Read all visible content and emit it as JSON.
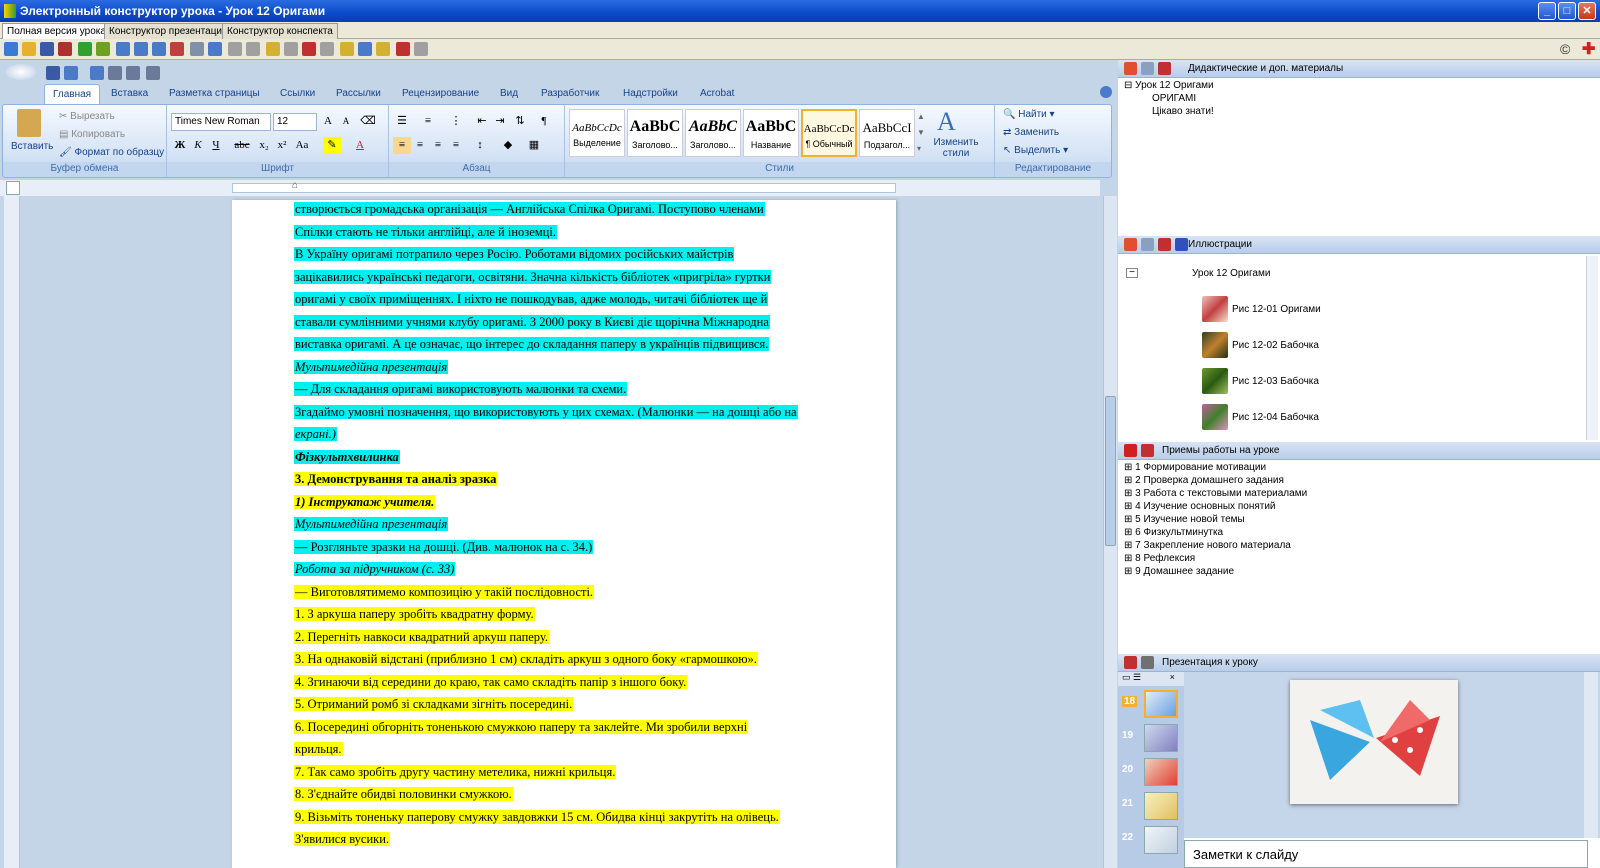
{
  "window": {
    "title": "Электронный конструктор урока - Урок 12 Оригами",
    "min": "_",
    "max": "□",
    "close": "✕"
  },
  "mode_tabs": [
    "Полная версия урока",
    "Конструктор презентации",
    "Конструктор конспекта"
  ],
  "ribbon": {
    "tabs": [
      "Главная",
      "Вставка",
      "Разметка страницы",
      "Ссылки",
      "Рассылки",
      "Рецензирование",
      "Вид",
      "Разработчик",
      "Надстройки",
      "Acrobat"
    ],
    "clipboard": {
      "paste": "Вставить",
      "cut": "Вырезать",
      "copy": "Копировать",
      "format_painter": "Формат по образцу",
      "label": "Буфер обмена"
    },
    "font": {
      "name": "Times New Roman",
      "size": "12",
      "label": "Шрифт"
    },
    "paragraph": {
      "label": "Абзац"
    },
    "styles": {
      "items": [
        {
          "sample": "AaBbCcDc",
          "name": "Выделение"
        },
        {
          "sample": "AaBbC",
          "name": "Заголово..."
        },
        {
          "sample": "AaBbC",
          "name": "Заголово..."
        },
        {
          "sample": "AaBbC",
          "name": "Название"
        },
        {
          "sample": "AaBbCcDc",
          "name": "¶ Обычный"
        },
        {
          "sample": "AaBbCcI",
          "name": "Подзагол..."
        }
      ],
      "change": "Изменить стили",
      "label": "Стили"
    },
    "editing": {
      "find": "Найти",
      "replace": "Заменить",
      "select": "Выделить",
      "label": "Редактирование"
    }
  },
  "document": {
    "lines": [
      {
        "t": "створюється громадська організація — Англійська Спілка Оригамі. Поступово членами",
        "h": "c"
      },
      {
        "t": "Спілки стають не тільки англійці, але й іноземці.",
        "h": "c"
      },
      {
        "t": "В Україну оригамі потрапило через Росію. Роботами відомих російських майстрів",
        "h": "c"
      },
      {
        "t": "зацікавились українські педагоги, освітяни. Значна кількість бібліотек «пригріла» гуртки",
        "h": "c"
      },
      {
        "t": "оригамі у своїх приміщеннях. І ніхто не пошкодував, адже молодь, читачі бібліотек ще й",
        "h": "c"
      },
      {
        "t": "ставали сумлінними учнями клубу оригамі. З 2000 року в Києві діє щорічна Міжнародна",
        "h": "c"
      },
      {
        "t": "виставка оригамі. А це означає, що інтерес до складання паперу в українців підвищився.",
        "h": "c"
      },
      {
        "t": "Мультимедійна презентація",
        "h": "c",
        "s": "i"
      },
      {
        "t": "— Для складання оригамі використовують малюнки та схеми.",
        "h": "c"
      },
      {
        "t": "Згадаймо умовні позначення, що використовують у цих схемах. (Малюнки — на дошці або на",
        "h": "c"
      },
      {
        "t": "екрані.)",
        "h": "c",
        "s": "i"
      },
      {
        "t": "Фізкультхвилинка",
        "h": "c",
        "s": "bi"
      },
      {
        "t": "3. Демонстрування та аналіз зразка",
        "h": "y",
        "s": "b"
      },
      {
        "t": "1) Інструктаж учителя.",
        "h": "y",
        "s": "bi"
      },
      {
        "t": "Мультимедійна презентація",
        "h": "c",
        "s": "i"
      },
      {
        "t": "— Розгляньте зразки на дошці. (Див. малюнок на с. 34.)",
        "h": "c"
      },
      {
        "t": "Робота за підручником (с. 33)",
        "h": "c",
        "s": "i"
      },
      {
        "t": "— Виготовлятимемо композицію у такій послідовності.",
        "h": "y"
      },
      {
        "t": "1. З аркуша паперу зробіть квадратну форму.",
        "h": "y"
      },
      {
        "t": "2. Перегніть навкоси квадратний аркуш паперу.",
        "h": "y"
      },
      {
        "t": "3. На однаковій відстані (приблизно 1 см) складіть аркуш з одного боку «гармошкою».",
        "h": "y"
      },
      {
        "t": "4. Згинаючи від середини до краю, так само складіть папір з іншого боку.",
        "h": "y"
      },
      {
        "t": "5. Отриманий ромб зі складками зігніть посередині.",
        "h": "y"
      },
      {
        "t": "6. Посередині обгорніть тоненькою смужкою паперу та заклейте. Ми зробили верхні",
        "h": "y"
      },
      {
        "t": "крильця.",
        "h": "y"
      },
      {
        "t": "7. Так само зробіть другу частину метелика, нижні крильця.",
        "h": "y"
      },
      {
        "t": "8. З'єднайте обидві половинки смужкою.",
        "h": "y"
      },
      {
        "t": "9. Візьміть тоненьку паперову смужку завдовжки 15 см. Обидва кінці закрутіть на олівець.",
        "h": "y"
      },
      {
        "t": "З'явилися вусики.",
        "h": "y"
      }
    ]
  },
  "panels": {
    "didactic": {
      "title": "Дидактические и доп. материалы",
      "root": "Урок 12 Оригами",
      "children": [
        "ОРИГАМІ",
        "Цікаво знати!"
      ]
    },
    "illustrations": {
      "title": "Иллюстрации",
      "root": "Урок 12 Оригами",
      "items": [
        "Рис 12-01 Оригами",
        "Рис 12-02 Бабочка",
        "Рис 12-03 Бабочка",
        "Рис 12-04 Бабочка"
      ]
    },
    "techniques": {
      "title": "Приемы работы на уроке",
      "items": [
        "1 Формирование мотивации",
        "2 Проверка домашнего задания",
        "3 Работа с текстовыми материалами",
        "4 Изучение основных понятий",
        "5 Изучение новой темы",
        "6 Физкультминутка",
        "7 Закрепление нового материала",
        "8 Рефлексия",
        "9 Домашнее задание"
      ]
    },
    "presentation": {
      "title": "Презентация к уроку",
      "slides": [
        "18",
        "19",
        "20",
        "21",
        "22"
      ],
      "notes": "Заметки к слайду"
    }
  }
}
